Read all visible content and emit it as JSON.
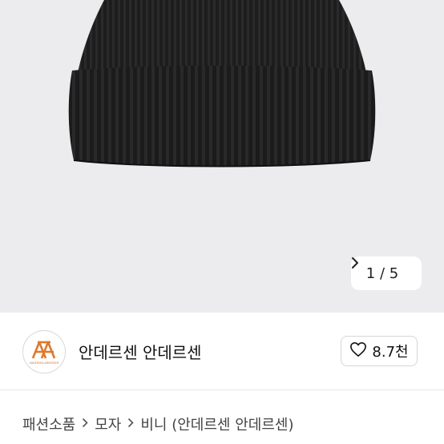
{
  "gallery": {
    "current": "1",
    "separator": "/",
    "total": "5",
    "next_icon": "chevron-right-icon"
  },
  "seller": {
    "name": "안데르센 안데르센",
    "avatar_icon": "andersen-logo",
    "logo_text": "ANDERSEN-ANDERSEN",
    "logo_color": "#e0782a"
  },
  "like": {
    "icon": "heart-outline-icon",
    "count": "8.7천"
  },
  "breadcrumb": {
    "items": [
      "패션소품",
      "모자",
      "비니 (안데르센 안데르센)"
    ],
    "separator_icon": "chevron-right-icon"
  },
  "colors": {
    "image_background": "#ececee",
    "product": "#1c1c1c"
  }
}
